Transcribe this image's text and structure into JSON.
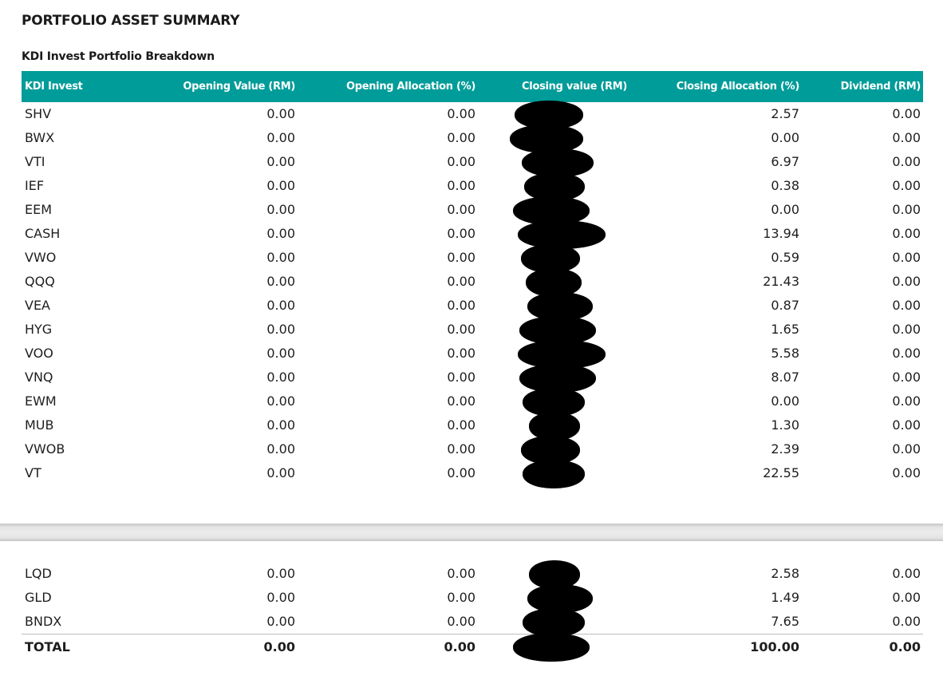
{
  "page_title": "PORTFOLIO ASSET SUMMARY",
  "section_title": "KDI Invest Portfolio Breakdown",
  "colors": {
    "header_bg": "#009c99",
    "header_text": "#ffffff"
  },
  "columns": [
    "KDI Invest",
    "Opening Value (RM)",
    "Opening Allocation (%)",
    "Closing value (RM)",
    "Closing Allocation (%)",
    "Dividend (RM)"
  ],
  "rows_page1": [
    {
      "name": "SHV",
      "opening_value": "0.00",
      "opening_alloc": "0.00",
      "closing_alloc": "2.57",
      "dividend": "0.00"
    },
    {
      "name": "BWX",
      "opening_value": "0.00",
      "opening_alloc": "0.00",
      "closing_alloc": "0.00",
      "dividend": "0.00"
    },
    {
      "name": "VTI",
      "opening_value": "0.00",
      "opening_alloc": "0.00",
      "closing_alloc": "6.97",
      "dividend": "0.00"
    },
    {
      "name": "IEF",
      "opening_value": "0.00",
      "opening_alloc": "0.00",
      "closing_alloc": "0.38",
      "dividend": "0.00"
    },
    {
      "name": "EEM",
      "opening_value": "0.00",
      "opening_alloc": "0.00",
      "closing_alloc": "0.00",
      "dividend": "0.00"
    },
    {
      "name": "CASH",
      "opening_value": "0.00",
      "opening_alloc": "0.00",
      "closing_alloc": "13.94",
      "dividend": "0.00"
    },
    {
      "name": "VWO",
      "opening_value": "0.00",
      "opening_alloc": "0.00",
      "closing_alloc": "0.59",
      "dividend": "0.00"
    },
    {
      "name": "QQQ",
      "opening_value": "0.00",
      "opening_alloc": "0.00",
      "closing_alloc": "21.43",
      "dividend": "0.00"
    },
    {
      "name": "VEA",
      "opening_value": "0.00",
      "opening_alloc": "0.00",
      "closing_alloc": "0.87",
      "dividend": "0.00"
    },
    {
      "name": "HYG",
      "opening_value": "0.00",
      "opening_alloc": "0.00",
      "closing_alloc": "1.65",
      "dividend": "0.00"
    },
    {
      "name": "VOO",
      "opening_value": "0.00",
      "opening_alloc": "0.00",
      "closing_alloc": "5.58",
      "dividend": "0.00"
    },
    {
      "name": "VNQ",
      "opening_value": "0.00",
      "opening_alloc": "0.00",
      "closing_alloc": "8.07",
      "dividend": "0.00"
    },
    {
      "name": "EWM",
      "opening_value": "0.00",
      "opening_alloc": "0.00",
      "closing_alloc": "0.00",
      "dividend": "0.00"
    },
    {
      "name": "MUB",
      "opening_value": "0.00",
      "opening_alloc": "0.00",
      "closing_alloc": "1.30",
      "dividend": "0.00"
    },
    {
      "name": "VWOB",
      "opening_value": "0.00",
      "opening_alloc": "0.00",
      "closing_alloc": "2.39",
      "dividend": "0.00"
    },
    {
      "name": "VT",
      "opening_value": "0.00",
      "opening_alloc": "0.00",
      "closing_alloc": "22.55",
      "dividend": "0.00"
    }
  ],
  "rows_page2": [
    {
      "name": "LQD",
      "opening_value": "0.00",
      "opening_alloc": "0.00",
      "closing_alloc": "2.58",
      "dividend": "0.00"
    },
    {
      "name": "GLD",
      "opening_value": "0.00",
      "opening_alloc": "0.00",
      "closing_alloc": "1.49",
      "dividend": "0.00"
    },
    {
      "name": "BNDX",
      "opening_value": "0.00",
      "opening_alloc": "0.00",
      "closing_alloc": "7.65",
      "dividend": "0.00"
    }
  ],
  "total": {
    "label": "TOTAL",
    "opening_value": "0.00",
    "opening_alloc": "0.00",
    "closing_alloc": "100.00",
    "dividend": "0.00"
  }
}
